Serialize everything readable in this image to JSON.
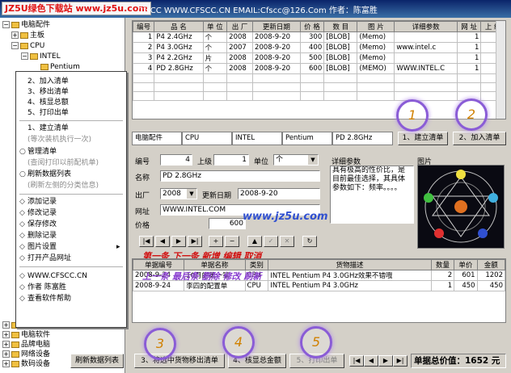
{
  "titlebar": {
    "watermark_site": "JZ5U绿色下载站",
    "watermark_url": "www.jz5u.com",
    "title": "CfsCC   WWW.CFSCC.CN   EMAIL:Cfscc@126.Com   作者：陈富胜"
  },
  "tree": {
    "root": "电脑配件",
    "mainboard": "主板",
    "cpu": "CPU",
    "intel": "INTEL",
    "pentium": "Pentium",
    "bottom_items": [
      "电脑耗材",
      "电脑软件",
      "品牌电脑",
      "网络设备",
      "数码设备"
    ]
  },
  "context_menu": {
    "items": [
      {
        "label": "2、加入清单",
        "mark": ""
      },
      {
        "label": "3、移出清单",
        "mark": ""
      },
      {
        "label": "4、核显总额",
        "mark": ""
      },
      {
        "label": "5、打印出单",
        "mark": ""
      },
      {
        "label": "1、建立清单",
        "mark": ""
      },
      {
        "label": "(等次装机执行一次)",
        "mark": "",
        "gray": true
      },
      {
        "label": "管理清单",
        "mark": "○"
      },
      {
        "label": "(查阅打印以前配机单)",
        "mark": "",
        "gray": true
      },
      {
        "label": "刷新数据列表",
        "mark": "○"
      },
      {
        "label": "(刷新左侧的分类信息)",
        "mark": "",
        "gray": true
      },
      {
        "label": "添加记录",
        "mark": "◇"
      },
      {
        "label": "修改记录",
        "mark": "◇"
      },
      {
        "label": "保存修改",
        "mark": "◇"
      },
      {
        "label": "删除记录",
        "mark": "◇"
      },
      {
        "label": "图片设置",
        "mark": "◇",
        "arrow": "▸"
      },
      {
        "label": "打开产品网址",
        "mark": "◇"
      },
      {
        "label": "WWW.CFSCC.CN",
        "mark": "◇"
      },
      {
        "label": "作者   陈富胜",
        "mark": "◇"
      },
      {
        "label": "查看软件帮助",
        "mark": "◇"
      }
    ]
  },
  "product_grid": {
    "headers": [
      "编号",
      "品 名",
      "单 位",
      "出 厂",
      "更新日期",
      "价 格",
      "数 目",
      "图 片",
      "详细参数",
      "网 址",
      "上 级"
    ],
    "rows": [
      [
        "1",
        "P4 2.4GHz",
        "个",
        "2008",
        "2008-9-20",
        "300",
        "[BLOB]",
        "(Memo)",
        "",
        "1",
        ""
      ],
      [
        "2",
        "P4 3.0GHz",
        "个",
        "2007",
        "2008-9-20",
        "400",
        "[BLOB]",
        "(Memo)",
        "www.intel.c",
        "1",
        ""
      ],
      [
        "3",
        "P4 2.2GHz",
        "片",
        "2008",
        "2008-9-20",
        "500",
        "[BLOB]",
        "(Memo)",
        "",
        "1",
        ""
      ],
      [
        "4",
        "PD 2.8GHz",
        "个",
        "2008",
        "2008-9-20",
        "600",
        "[BLOB]",
        "(MEMO)",
        "WWW.INTEL.C",
        "1",
        ""
      ]
    ]
  },
  "path_bar": [
    "电脑配件",
    "CPU",
    "INTEL",
    "Pentium",
    "PD 2.8GHz"
  ],
  "buttons": {
    "build_list": "1、建立清单",
    "add_list": "2、加入清单",
    "remove_list": "3、将选中货物移出清单",
    "total": "4、核显总金额",
    "print": "5、打印出单",
    "refresh": "刷新数据列表"
  },
  "form": {
    "id_label": "编号",
    "id_value": "4",
    "parent_label": "上级",
    "parent_value": "1",
    "unit_label": "单位",
    "unit_value": "个",
    "name_label": "名称",
    "name_value": "PD 2.8GHz",
    "factory_label": "出厂",
    "factory_value": "2008",
    "update_label": "更新日期",
    "update_value": "2008-9-20",
    "url_label": "网址",
    "url_value": "WWW.INTEL.COM",
    "price_label": "价格",
    "price_value": "600",
    "detail_label": "详细参数",
    "detail_value": "具有极高的性价比，是目前最佳选择，其具体参数如下：频率。。。。",
    "image_label": "图片"
  },
  "overlay": {
    "watermark": "www.jz5u.com",
    "nav_caption1": "第一条 下一条 新增 编辑 取消",
    "nav_caption2": "上一条 最后条 删除 修改 刷新",
    "circles": [
      "1",
      "2",
      "3",
      "4",
      "5"
    ]
  },
  "order_grid": {
    "headers": [
      "单据编号",
      "单据名称",
      "类别",
      "货物描述",
      "数量",
      "单价",
      "金额"
    ],
    "rows": [
      [
        "2008-9-24",
        "10月的第一笔",
        "CPU",
        "INTEL Pentium P4 3.0GHz效果不错哦",
        "2",
        "601",
        "1202"
      ],
      [
        "2008-9-24",
        "李四的配置单",
        "CPU",
        "INTEL Pentium P4 3.0GHz",
        "1",
        "450",
        "450"
      ]
    ]
  },
  "status": {
    "total_label": "单据总价值：",
    "total_value": "1652 元"
  },
  "colors": {
    "title_bar": "#0a246a",
    "watermark_red": "#e01010",
    "circle_purple": "#8a5cd6"
  }
}
